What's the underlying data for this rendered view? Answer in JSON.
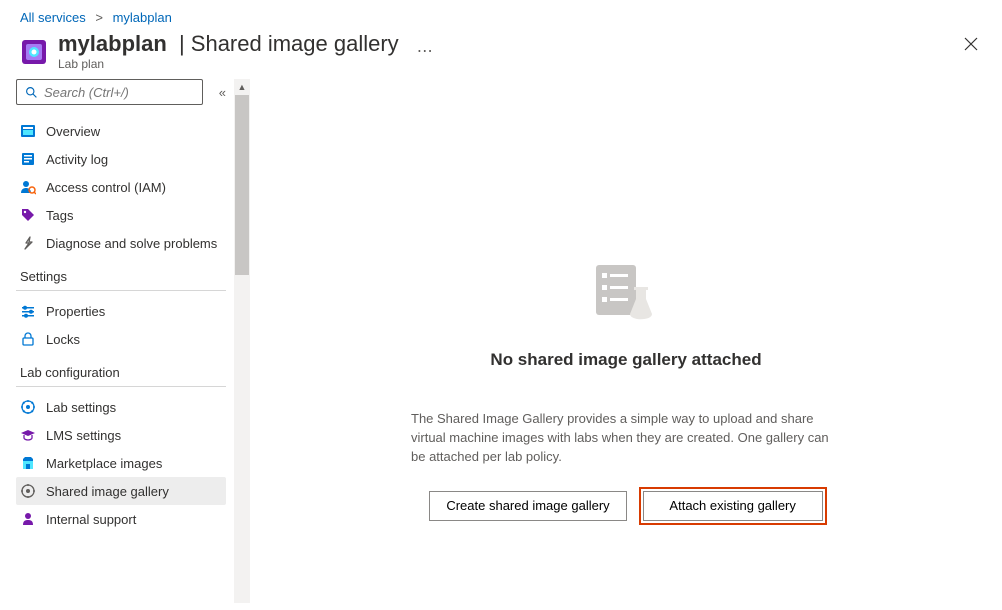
{
  "breadcrumb": {
    "root": "All services",
    "current": "mylabplan"
  },
  "header": {
    "title_bold": "mylabplan",
    "title_sep": "|",
    "title_thin": "Shared image gallery",
    "subtitle": "Lab plan"
  },
  "search": {
    "placeholder": "Search (Ctrl+/)"
  },
  "nav": {
    "overview": "Overview",
    "activity_log": "Activity log",
    "access_control": "Access control (IAM)",
    "tags": "Tags",
    "diagnose": "Diagnose and solve problems",
    "section_settings": "Settings",
    "properties": "Properties",
    "locks": "Locks",
    "section_labconfig": "Lab configuration",
    "lab_settings": "Lab settings",
    "lms_settings": "LMS settings",
    "marketplace": "Marketplace images",
    "shared_image": "Shared image gallery",
    "internal_support": "Internal support"
  },
  "empty": {
    "title": "No shared image gallery attached",
    "desc": "The Shared Image Gallery provides a simple way to upload and share virtual machine images with labs when they are created. One gallery can be attached per lab policy.",
    "btn_create": "Create shared image gallery",
    "btn_attach": "Attach existing gallery"
  }
}
